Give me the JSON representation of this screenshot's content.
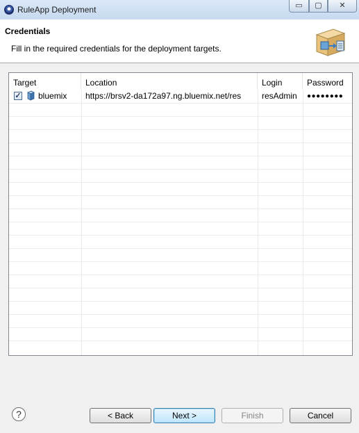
{
  "window": {
    "title": "RuleApp Deployment",
    "minimize_glyph": "▭",
    "maximize_glyph": "▢",
    "close_glyph": "✕"
  },
  "header": {
    "title": "Credentials",
    "description": "Fill in the required credentials for the deployment targets."
  },
  "table": {
    "columns": [
      "Target",
      "Location",
      "Login",
      "Password"
    ],
    "rows": [
      {
        "checked": true,
        "check_glyph": "✓",
        "target": "bluemix",
        "location": "https://brsv2-da172a97.ng.bluemix.net/res",
        "login": "resAdmin",
        "password": "●●●●●●●●"
      }
    ]
  },
  "footer": {
    "help_glyph": "?",
    "back_label": "< Back",
    "next_label": "Next >",
    "finish_label": "Finish",
    "cancel_label": "Cancel",
    "finish_enabled": false
  },
  "icons": {
    "app": "eclipse-icon",
    "target": "server-icon",
    "header": "deployment-wizard-icon",
    "help": "help-icon"
  }
}
